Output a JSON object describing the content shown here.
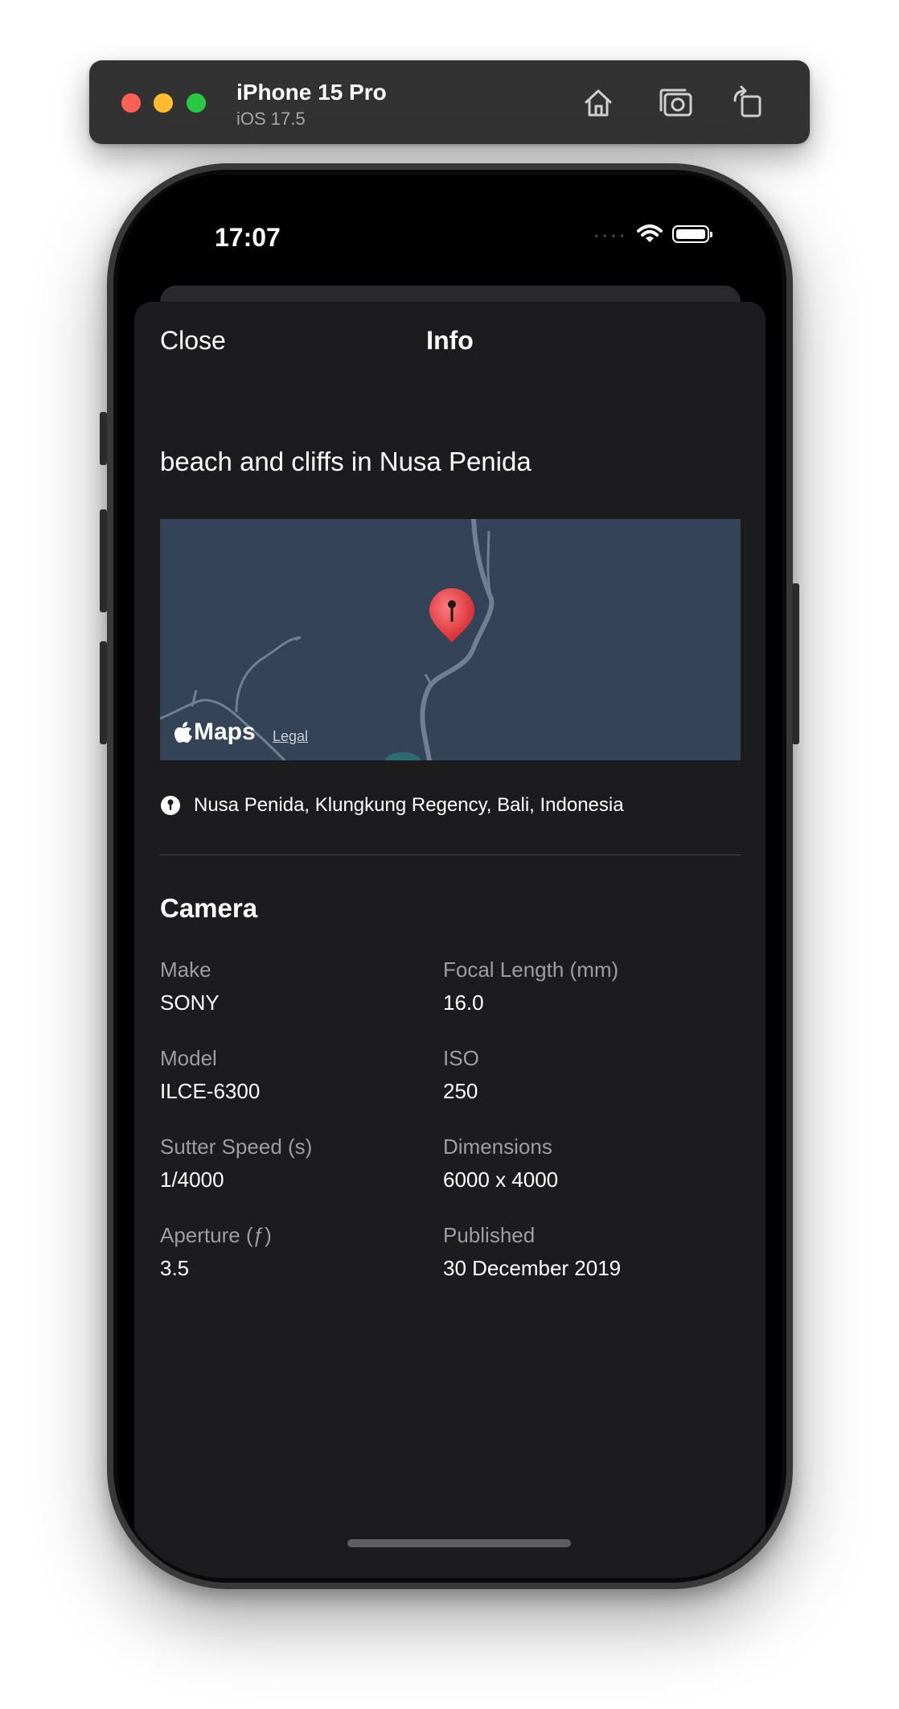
{
  "simulator": {
    "device_name": "iPhone 15 Pro",
    "os_version": "iOS 17.5",
    "buttons": [
      "home-icon",
      "screenshot-icon",
      "rotate-icon"
    ]
  },
  "status_bar": {
    "time": "17:07",
    "icons": [
      "cellular-dots",
      "wifi-icon",
      "battery-icon"
    ]
  },
  "sheet": {
    "close_label": "Close",
    "title": "Info",
    "description": "beach and cliffs in Nusa Penida",
    "map": {
      "brand": "Maps",
      "legal_label": "Legal",
      "pin_icon": "map-pin-icon"
    },
    "location": "Nusa Penida, Klungkung Regency, Bali, Indonesia",
    "camera": {
      "title": "Camera",
      "specs": [
        {
          "label": "Make",
          "value": "SONY"
        },
        {
          "label": "Focal Length (mm)",
          "value": "16.0"
        },
        {
          "label": "Model",
          "value": "ILCE-6300"
        },
        {
          "label": "ISO",
          "value": "250"
        },
        {
          "label": "Sutter Speed (s)",
          "value": "1/4000"
        },
        {
          "label": "Dimensions",
          "value": "6000 x 4000"
        },
        {
          "label": "Aperture (ƒ)",
          "value": "3.5"
        },
        {
          "label": "Published",
          "value": "30 December 2019"
        }
      ]
    }
  },
  "colors": {
    "sheet_background": "#1c1c1e",
    "map_background": "#344358",
    "pin_red": "#e5383b",
    "secondary_text": "#9d9da3"
  }
}
